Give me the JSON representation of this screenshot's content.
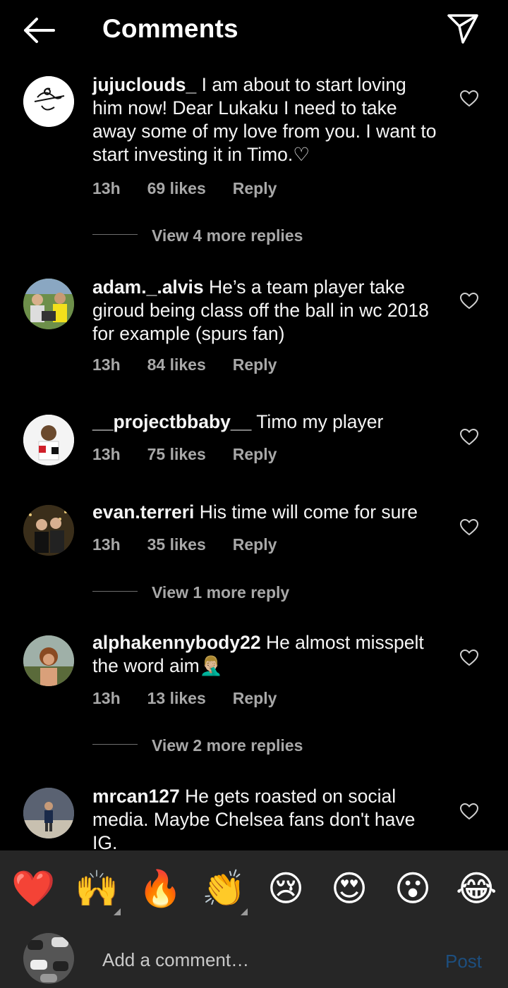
{
  "header": {
    "title": "Comments"
  },
  "comments": [
    {
      "user": "jujuclouds_",
      "text": " I am about to start loving him now! Dear Lukaku I need to take away some of my love from you. I want to start investing it in Timo.♡",
      "time": "13h",
      "likes": "69 likes",
      "reply": "Reply",
      "view_more": "View 4 more replies"
    },
    {
      "user": "adam._.alvis",
      "text": " He’s a team player take giroud being class off the ball in wc 2018 for example (spurs fan)",
      "time": "13h",
      "likes": "84 likes",
      "reply": "Reply"
    },
    {
      "user": "__projectbbaby__",
      "text": " Timo my player",
      "time": "13h",
      "likes": "75 likes",
      "reply": "Reply"
    },
    {
      "user": "evan.terreri",
      "text": " His time will come for sure",
      "time": "13h",
      "likes": "35 likes",
      "reply": "Reply",
      "view_more": "View 1 more reply"
    },
    {
      "user": "alphakennybody22",
      "text": " He almost misspelt the word aim🤦🏼‍♂️",
      "time": "13h",
      "likes": "13 likes",
      "reply": "Reply",
      "view_more": "View 2 more replies"
    },
    {
      "user": "mrcan127",
      "text": " He gets roasted on social media. Maybe Chelsea fans don't have IG."
    }
  ],
  "emojis": [
    "❤️",
    "🙌",
    "🔥",
    "👏",
    "😢",
    "😍",
    "😮",
    "😂"
  ],
  "composer": {
    "placeholder": "Add a comment…",
    "post_label": "Post"
  }
}
